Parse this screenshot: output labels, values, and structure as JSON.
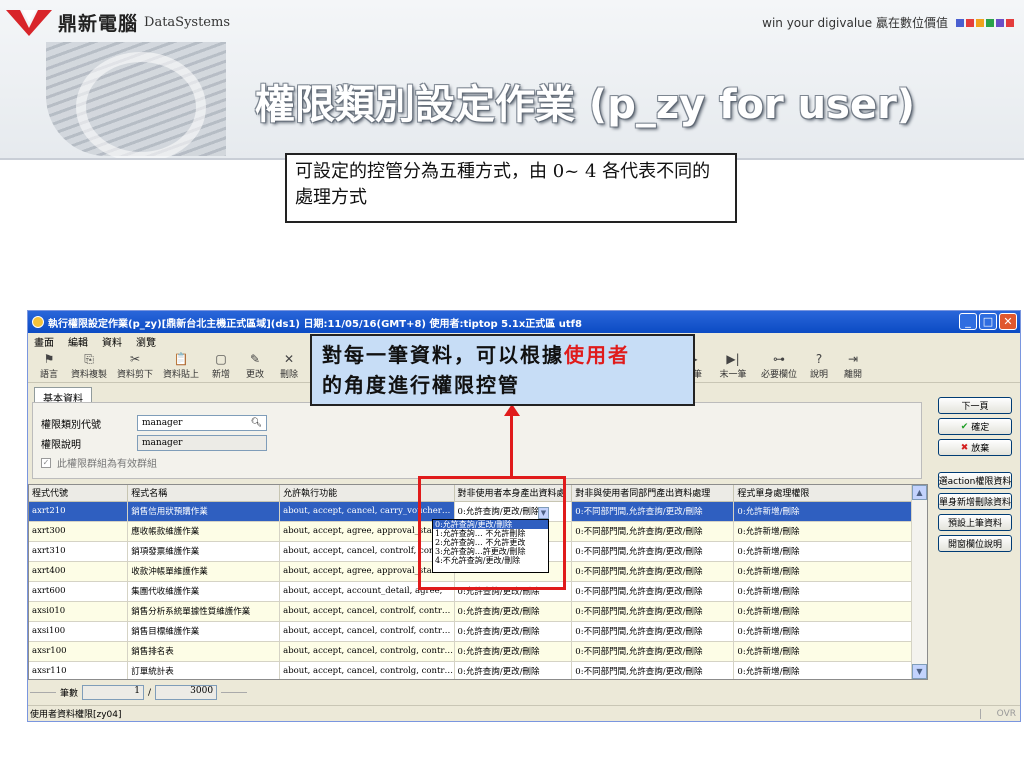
{
  "header": {
    "logo_zh": "鼎新電腦",
    "logo_en": "DataSystems",
    "slogan": "win your digivalue 贏在數位價值",
    "slogan_colors": [
      "#4a5fd0",
      "#e43c3c",
      "#f0a21c",
      "#2aa24a",
      "#6b4fc7",
      "#e43c3c"
    ],
    "title": "權限類別設定作業 (p_zy for user)"
  },
  "note": "可設定的控管分為五種方式，由 0~ 4 各代表不同的處理方式",
  "callout": {
    "part1": "對每一筆資料，可以根據",
    "highlight": "使用者",
    "part2": "的角度進行權限控管"
  },
  "window": {
    "title": "執行權限設定作業(p_zy)[鼎新台北主機正式區域](ds1)  日期:11/05/16(GMT+8)  使用者:tiptop 5.1x正式區 utf8",
    "menus": [
      "畫面",
      "編輯",
      "資料",
      "瀏覽"
    ],
    "tools": [
      {
        "icon": "flag-icon",
        "glyph": "⚑",
        "label": "語言"
      },
      {
        "icon": "copy-icon",
        "glyph": "⎘",
        "label": "資料複製"
      },
      {
        "icon": "cut-icon",
        "glyph": "✂",
        "label": "資料剪下"
      },
      {
        "icon": "paste-icon",
        "glyph": "📋",
        "label": "資料貼上"
      },
      {
        "icon": "new-icon",
        "glyph": "▢",
        "label": "新增"
      },
      {
        "icon": "edit-icon",
        "glyph": "✎",
        "label": "更改"
      },
      {
        "icon": "delete-icon",
        "glyph": "✕",
        "label": "刪除"
      }
    ],
    "tools_right": [
      {
        "icon": "next-icon",
        "glyph": "▶",
        "label": "下筆"
      },
      {
        "icon": "last-icon",
        "glyph": "▶|",
        "label": "末一筆"
      },
      {
        "icon": "key-icon",
        "glyph": "⊶",
        "label": "必要欄位"
      },
      {
        "icon": "help-icon",
        "glyph": "?",
        "label": "說明"
      },
      {
        "icon": "exit-icon",
        "glyph": "⇥",
        "label": "離開"
      }
    ],
    "tab": "基本資料",
    "fields": {
      "category_code_label": "權限類別代號",
      "category_code_value": "manager",
      "description_label": "權限說明",
      "description_value": "manager",
      "group_valid_label": "此權限群組為有效群組"
    },
    "side_buttons": [
      "下一頁",
      "確定",
      "放棄",
      "選action權限資料",
      "單身新增刪除資料",
      "預設上筆資料",
      "開窗欄位說明"
    ],
    "columns": [
      "程式代號",
      "程式名稱",
      "允許執行功能",
      "對非使用者本身產出資料處",
      "對非與使用者同部門產出資料處理",
      "程式單身處理權限"
    ],
    "rows": [
      [
        "axrt210",
        "銷售信用狀預購作業",
        "about, accept, cancel, carry_voucher…",
        "0:允許查詢/更改/刪除",
        "0:不同部門間,允許查詢/更改/刪除",
        "0:允許新增/刪除"
      ],
      [
        "axrt300",
        "應收帳款維護作業",
        "about, accept, agree, approval_status…",
        "",
        "0:不同部門間,允許查詢/更改/刪除",
        "0:允許新增/刪除"
      ],
      [
        "axrt310",
        "銷項發票維護作業",
        "about, accept, cancel, controlf, contr…",
        "",
        "0:不同部門間,允許查詢/更改/刪除",
        "0:允許新增/刪除"
      ],
      [
        "axrt400",
        "收款沖帳單維護作業",
        "about, accept, agree, approval_status…",
        "",
        "0:不同部門間,允許查詢/更改/刪除",
        "0:允許新增/刪除"
      ],
      [
        "axrt600",
        "集團代收維護作業",
        "about, accept, account_detail, agree,",
        "0:允許查詢/更改/刪除",
        "0:不同部門間,允許查詢/更改/刪除",
        "0:允許新增/刪除"
      ],
      [
        "axsi010",
        "銷售分析系統單據性質維護作業",
        "about, accept, cancel, controlf, contr…",
        "0:允許查詢/更改/刪除",
        "0:不同部門間,允許查詢/更改/刪除",
        "0:允許新增/刪除"
      ],
      [
        "axsi100",
        "銷售目標維護作業",
        "about, accept, cancel, controlf, contr…",
        "0:允許查詢/更改/刪除",
        "0:不同部門間,允許查詢/更改/刪除",
        "0:允許新增/刪除"
      ],
      [
        "axsr100",
        "銷售排名表",
        "about, accept, cancel, controlg, contr…",
        "0:允許查詢/更改/刪除",
        "0:不同部門間,允許查詢/更改/刪除",
        "0:允許新增/刪除"
      ],
      [
        "axsr110",
        "訂單統計表",
        "about, accept, cancel, controlg, contr…",
        "0:允許查詢/更改/刪除",
        "0:不同部門間,允許查詢/更改/刪除",
        "0:允許新增/刪除"
      ]
    ],
    "dropdown_options": [
      "0:允許查詢/更改/刪除",
      "1:允許查詢… 不允許刪除",
      "2:允許查詢… 不允許更改",
      "3:允許查詢…許更改/刪除",
      "4:不允許查詢/更改/刪除"
    ],
    "pager": {
      "label": "筆數",
      "current": "1",
      "separator": "/",
      "total": "3000"
    },
    "status": "使用者資料權限[zy04]",
    "ovr": "OVR"
  }
}
